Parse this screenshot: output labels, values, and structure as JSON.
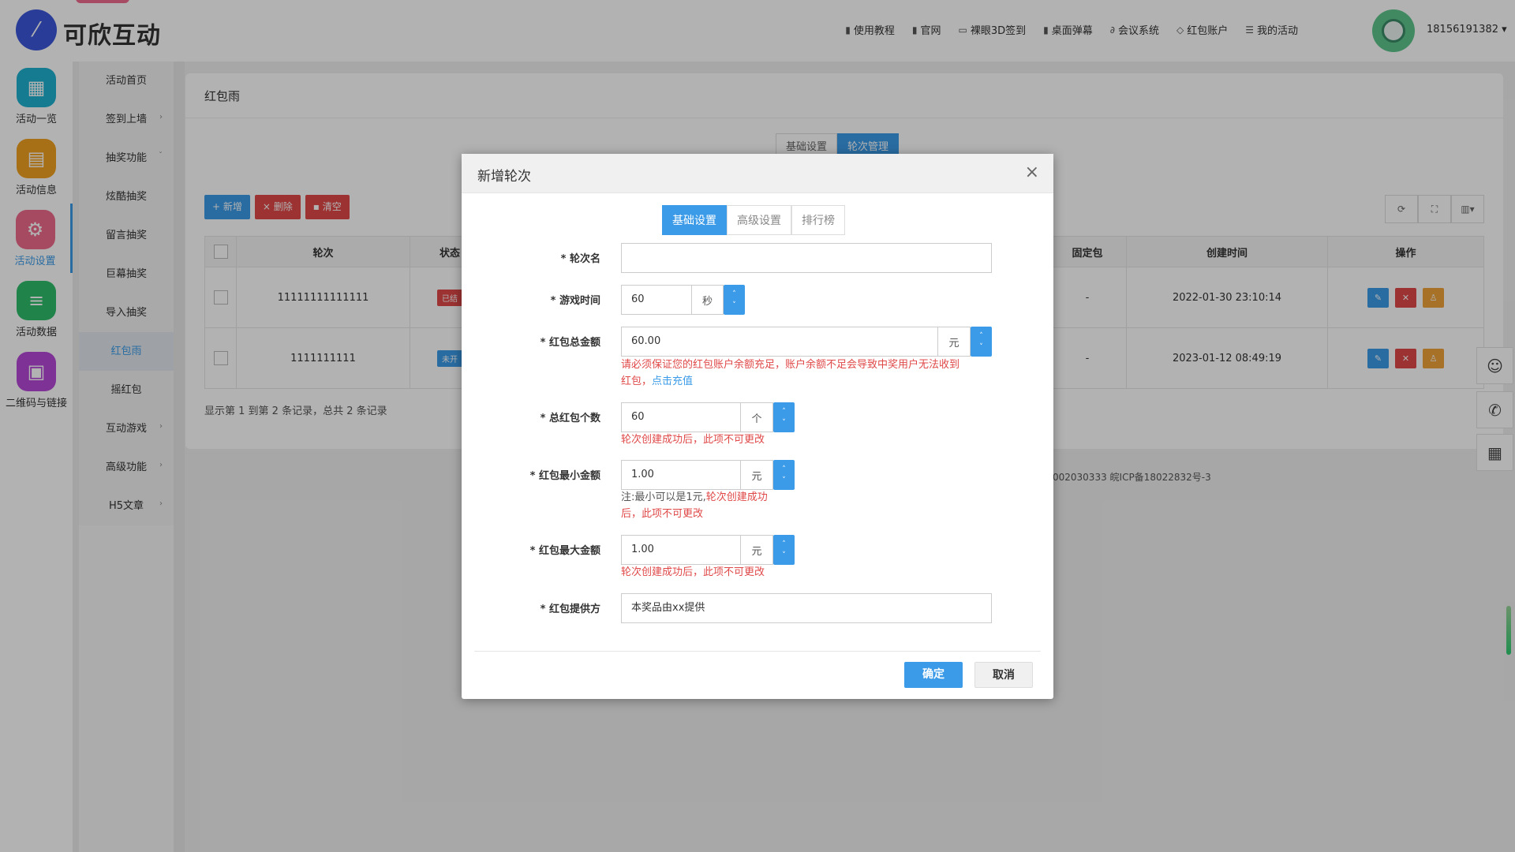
{
  "app": {
    "name": "可欣互动"
  },
  "topnav": {
    "items": [
      {
        "label": "使用教程",
        "icon": "doc-icon"
      },
      {
        "label": "官网",
        "icon": "doc-icon"
      },
      {
        "label": "裸眼3D签到",
        "icon": "monitor-icon"
      },
      {
        "label": "桌面弹幕",
        "icon": "doc-icon"
      },
      {
        "label": "会议系统",
        "icon": "link-icon"
      },
      {
        "label": "红包账户",
        "icon": "diamond-icon"
      },
      {
        "label": "我的活动",
        "icon": "list-icon"
      }
    ],
    "phone": "18156191382 ▾"
  },
  "iconbar": {
    "items": [
      {
        "label": "活动一览",
        "color": "#1fb1d0"
      },
      {
        "label": "活动信息",
        "color": "#f0a020"
      },
      {
        "label": "活动设置",
        "color": "#ee6b8b"
      },
      {
        "label": "活动数据",
        "color": "#2ebd6b"
      },
      {
        "label": "二维码与链接",
        "color": "#b548d6"
      }
    ]
  },
  "submenu": {
    "items": [
      {
        "label": "活动首页",
        "arrow": ""
      },
      {
        "label": "签到上墙",
        "arrow": "›"
      },
      {
        "label": "抽奖功能",
        "arrow": "ˇ"
      },
      {
        "label": "炫酷抽奖",
        "arrow": ""
      },
      {
        "label": "留言抽奖",
        "arrow": ""
      },
      {
        "label": "巨幕抽奖",
        "arrow": ""
      },
      {
        "label": "导入抽奖",
        "arrow": ""
      },
      {
        "label": "红包雨",
        "arrow": ""
      },
      {
        "label": "摇红包",
        "arrow": ""
      },
      {
        "label": "互动游戏",
        "arrow": "›"
      },
      {
        "label": "高级功能",
        "arrow": "›"
      },
      {
        "label": "H5文章",
        "arrow": "›"
      }
    ]
  },
  "panel": {
    "title": "红包雨",
    "tabs": [
      "基础设置",
      "轮次管理"
    ],
    "buttons": {
      "add": "+ 新增",
      "delete": "× 删除",
      "clear": "▪ 清空"
    },
    "table": {
      "headers": [
        "轮次",
        "状态",
        "固定包",
        "创建时间",
        "操作"
      ],
      "rows": [
        {
          "round": "11111111111111",
          "status": "已结",
          "status_color": "#e04848",
          "fixed": "-",
          "created": "2022-01-30 23:10:14"
        },
        {
          "round": "1111111111",
          "status": "未开",
          "status_color": "#3b9be8",
          "fixed": "-",
          "created": "2023-01-12 08:49:19"
        }
      ]
    },
    "summary": "显示第 1 到第 2 条记录，总共 2 条记录",
    "icp": "002030333 皖ICP备18022832号-3"
  },
  "modal": {
    "title": "新增轮次",
    "tabs": [
      "基础设置",
      "高级设置",
      "排行榜"
    ],
    "fields": {
      "round_name": {
        "label": "* 轮次名",
        "value": ""
      },
      "game_time": {
        "label": "* 游戏时间",
        "value": "60",
        "unit": "秒"
      },
      "total_amount": {
        "label": "* 红包总金额",
        "value": "60.00",
        "unit": "元",
        "hint_a": "请必须保证您的红包账户余额充足，账户余额不足会导致中奖用户无法收到",
        "hint_b": "红包，",
        "hint_link": "点击充值"
      },
      "total_count": {
        "label": "* 总红包个数",
        "value": "60",
        "unit": "个",
        "hint": "轮次创建成功后，此项不可更改"
      },
      "min_amount": {
        "label": "* 红包最小金额",
        "value": "1.00",
        "unit": "元",
        "hint_note": "注:最小可以是1元,",
        "hint_a": "轮次创建成功",
        "hint_b": "后，此项不可更改"
      },
      "max_amount": {
        "label": "* 红包最大金额",
        "value": "1.00",
        "unit": "元",
        "hint": "轮次创建成功后，此项不可更改"
      },
      "provider": {
        "label": "* 红包提供方",
        "value": "本奖品由xx提供"
      }
    },
    "confirm": "确定",
    "cancel": "取消"
  },
  "colors": {
    "accent": "#3b9be8",
    "danger": "#e04848",
    "warning": "#f0a33a"
  }
}
